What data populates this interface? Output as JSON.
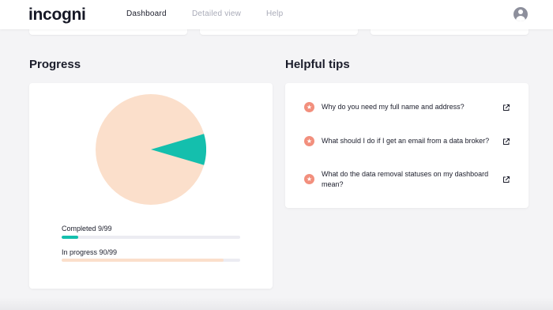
{
  "header": {
    "logo": "incogni",
    "nav": [
      {
        "label": "Dashboard",
        "active": true
      },
      {
        "label": "Detailed view",
        "active": false
      },
      {
        "label": "Help",
        "active": false
      }
    ]
  },
  "progress": {
    "title": "Progress",
    "completed": {
      "label": "Completed 9/99",
      "value": 9,
      "total": 99,
      "color": "#14bfad"
    },
    "in_progress": {
      "label": "In progress 90/99",
      "value": 90,
      "total": 99,
      "color": "#fbdfcb"
    }
  },
  "tips": {
    "title": "Helpful tips",
    "items": [
      {
        "text": "Why do you need my full name and address?"
      },
      {
        "text": "What should I do if I get an email from a data broker?"
      },
      {
        "text": "What do the data removal statuses on my dashboard mean?"
      }
    ]
  },
  "colors": {
    "accent_teal": "#14bfad",
    "pie_peach": "#fbdfcb",
    "tip_icon": "#f28f7d"
  },
  "icons": {
    "tip": "star-icon",
    "tip_link": "external-link-icon",
    "avatar": "user-avatar-icon"
  }
}
